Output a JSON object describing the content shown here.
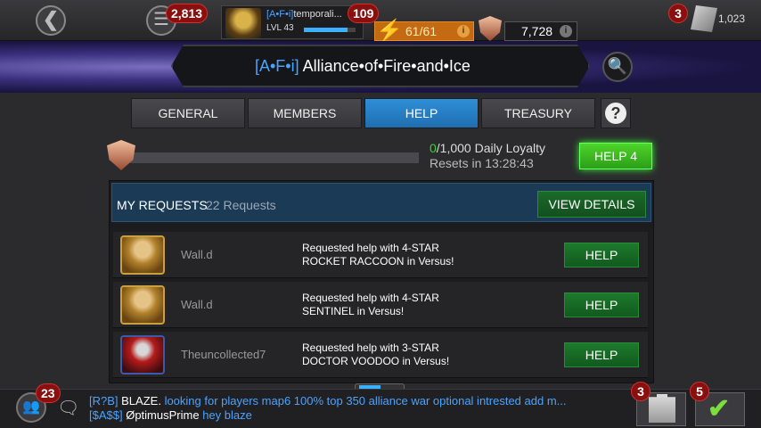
{
  "top_bar": {
    "back_icon": "chevron-left-icon",
    "menu_badge": "2,813",
    "player_tag": "[A•F•i]",
    "player_name": "temporali...",
    "player_level": "LVL 43",
    "xp_progress": 0.85,
    "player_badge": "109",
    "energy": "61/61",
    "loyalty": "7,728",
    "units_badge": "3",
    "units": "1,023"
  },
  "alliance": {
    "tag": "[A•F•i]",
    "name": "Alliance•of•Fire•and•Ice"
  },
  "tabs": [
    "GENERAL",
    "MEMBERS",
    "HELP",
    "TREASURY"
  ],
  "active_tab": "HELP",
  "help_tab_question": "?",
  "daily": {
    "current": "0",
    "rest": "/1,000 Daily Loyalty",
    "resets": "Resets in 13:28:43",
    "progress": 0.0,
    "help_all_label": "HELP 4"
  },
  "requests": {
    "title": "MY REQUESTS",
    "count": "22 Requests",
    "view_details_label": "VIEW DETAILS",
    "rows": [
      {
        "user": "Wall.d",
        "line1": "Requested help with 4-STAR",
        "line2": "ROCKET RACCOON in Versus!",
        "button": "HELP"
      },
      {
        "user": "Wall.d",
        "line1": "Requested help with 4-STAR",
        "line2": "SENTINEL in Versus!",
        "button": "HELP"
      },
      {
        "user": "Theuncollected7",
        "line1": "Requested help with 3-STAR",
        "line2": "DOCTOR VOODOO in Versus!",
        "button": "HELP"
      }
    ]
  },
  "chat": {
    "people_badge": "23",
    "line1": {
      "tag": "[R?B]",
      "who": "BLAZE.",
      "msg": "looking for players map6 100% top 350 alliance war optional intrested add m..."
    },
    "line2": {
      "tag": "[$A$$]",
      "who": "ØptimusPrime",
      "msg": "hey blaze"
    },
    "quests_badge": "3",
    "claims_badge": "5"
  },
  "colors": {
    "accent_blue": "#4aa3ff",
    "help_green": "#2c9e18",
    "badge_red": "#8a1010"
  }
}
